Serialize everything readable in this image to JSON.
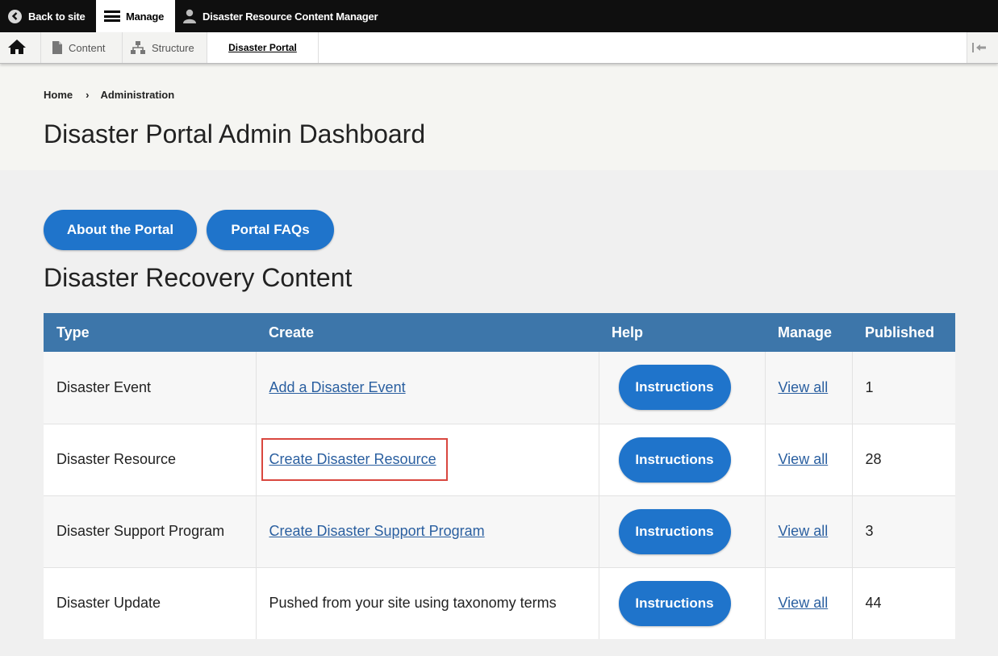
{
  "toolbar": {
    "back_label": "Back to site",
    "manage_label": "Manage",
    "user_label": "Disaster Resource Content Manager"
  },
  "tray": {
    "content_label": "Content",
    "structure_label": "Structure",
    "portal_label": "Disaster Portal"
  },
  "breadcrumb": {
    "home": "Home",
    "separator": "›",
    "current": "Administration"
  },
  "page": {
    "title": "Disaster Portal Admin Dashboard",
    "section_title": "Disaster Recovery Content"
  },
  "buttons": {
    "about": "About the Portal",
    "faq": "Portal FAQs"
  },
  "table": {
    "headers": [
      "Type",
      "Create",
      "Help",
      "Manage",
      "Published"
    ],
    "rows": [
      {
        "type": "Disaster Event",
        "create": "Add a Disaster Event",
        "create_is_link": true,
        "help": "Instructions",
        "manage": "View all",
        "published": "1"
      },
      {
        "type": "Disaster Resource",
        "create": "Create Disaster Resource",
        "create_is_link": true,
        "help": "Instructions",
        "manage": "View all",
        "published": "28"
      },
      {
        "type": "Disaster Support Program",
        "create": "Create Disaster Support Program",
        "create_is_link": true,
        "help": "Instructions",
        "manage": "View all",
        "published": "3"
      },
      {
        "type": "Disaster Update",
        "create": "Pushed from your site using taxonomy terms",
        "create_is_link": false,
        "help": "Instructions",
        "manage": "View all",
        "published": "44"
      }
    ]
  },
  "colors": {
    "accent": "#1f74cb",
    "table_header": "#3d76aa",
    "link": "#2a5fa0",
    "highlight": "#d9473f"
  }
}
